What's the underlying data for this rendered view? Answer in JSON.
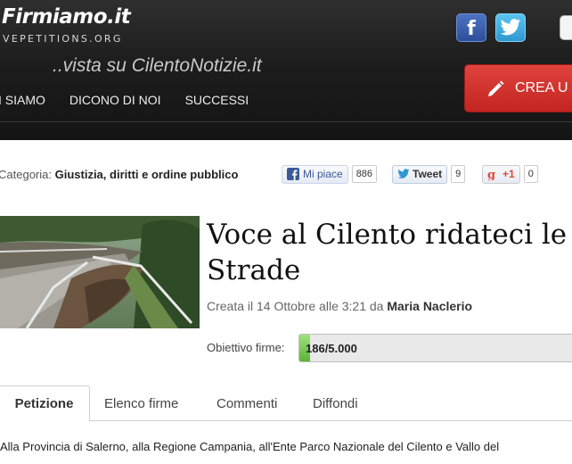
{
  "header": {
    "logo": "Firmiamo.it",
    "logo_sub": "VEPETITIONS.ORG",
    "tagline": "..vista su CilentoNotizie.it",
    "nav": [
      "I SIAMO",
      "DICONO DI NOI",
      "SUCCESSI"
    ],
    "create_button": "CREA U",
    "facebook_glyph": "f",
    "icons": [
      "facebook-icon",
      "twitter-icon",
      "pencil-icon"
    ]
  },
  "category": {
    "label": "Categoria:",
    "value": "Giustizia, diritti e ordine pubblico"
  },
  "share": {
    "facebook_label": "Mi piace",
    "facebook_count": "886",
    "twitter_label": "Tweet",
    "twitter_count": "9",
    "gplus_label": "+1",
    "gplus_count": "0"
  },
  "petition": {
    "title": "Voce al Cilento ridateci le Strade",
    "created_prefix": "Creata il 14 Ottobre alle 3:21 da",
    "author": "Maria Naclerio",
    "goal_label": "Obiettivo firme:",
    "goal_text": "186/5.000",
    "goal_fraction": 0.0372
  },
  "tabs": [
    "Petizione",
    "Elenco firme",
    "Commenti",
    "Diffondi"
  ],
  "body_text": "Alla Provincia di Salerno, alla Regione Campania, all'Ente Parco Nazionale del Cilento e Vallo del",
  "colors": {
    "create_button": "#c22520",
    "progress": "#5cb336",
    "facebook": "#3b5998",
    "twitter": "#2e98d0"
  }
}
